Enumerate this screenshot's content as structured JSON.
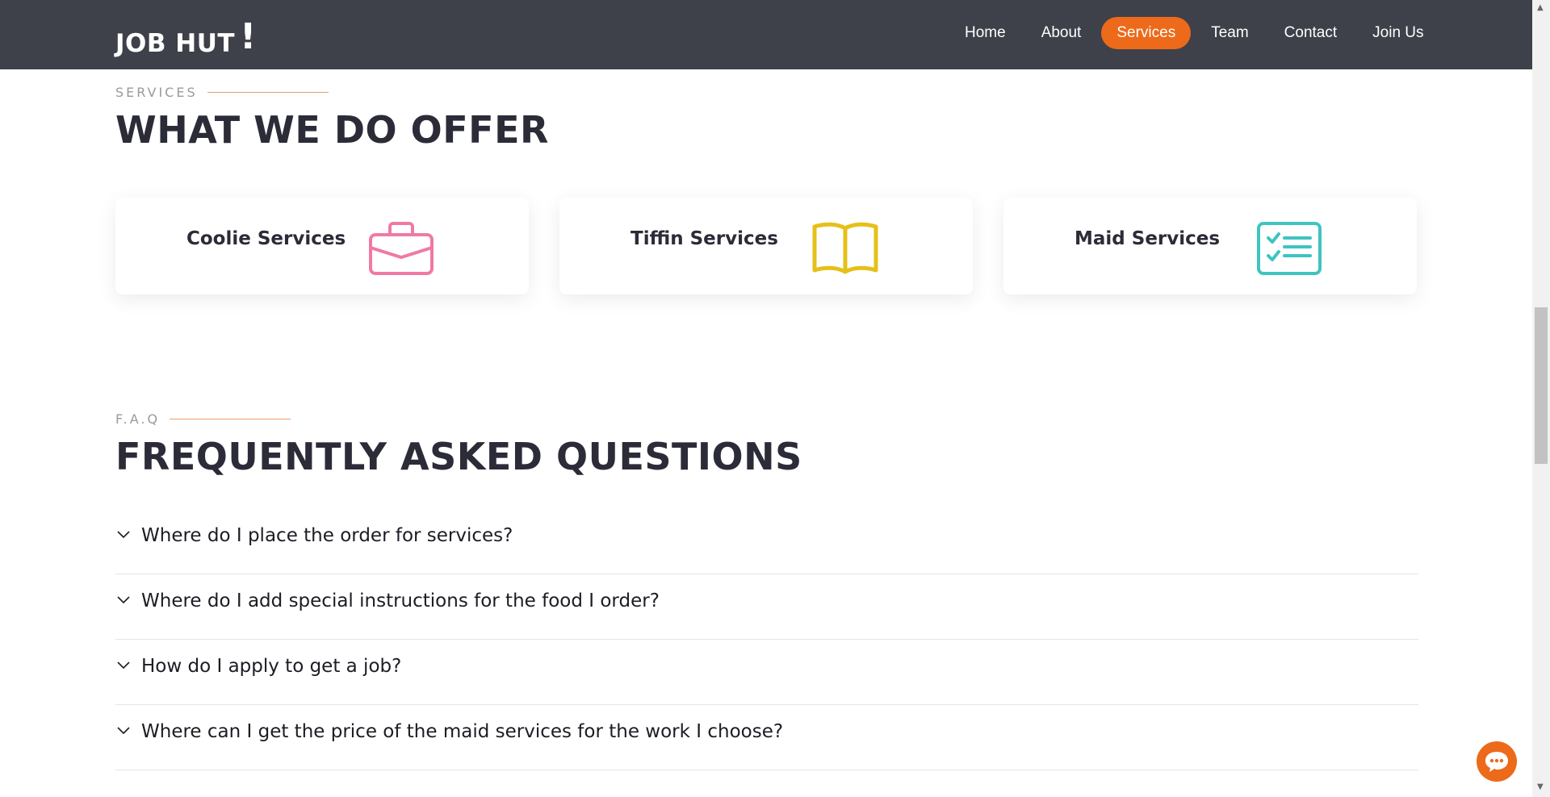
{
  "header": {
    "logo_text": "JOB HUT",
    "logo_mark": "!",
    "nav": [
      {
        "label": "Home",
        "active": false
      },
      {
        "label": "About",
        "active": false
      },
      {
        "label": "Services",
        "active": true
      },
      {
        "label": "Team",
        "active": false
      },
      {
        "label": "Contact",
        "active": false
      },
      {
        "label": "Join Us",
        "active": false
      }
    ]
  },
  "services": {
    "eyebrow": "SERVICES",
    "heading": "WHAT WE DO OFFER",
    "cards": [
      {
        "title": "Coolie Services",
        "icon": "briefcase-icon",
        "color": "#ef7aa5"
      },
      {
        "title": "Tiffin Services",
        "icon": "book-icon",
        "color": "#e6c018"
      },
      {
        "title": "Maid Services",
        "icon": "checklist-icon",
        "color": "#3fc4c0"
      }
    ]
  },
  "faq": {
    "eyebrow": "F.A.Q",
    "heading": "FREQUENTLY ASKED QUESTIONS",
    "items": [
      "Where do I place the order for services?",
      "Where do I add special instructions for the food I order?",
      "How do I apply to get a job?",
      "Where can I get the price of the maid services for the work I choose?"
    ]
  },
  "colors": {
    "header_bg": "#3e4149",
    "accent": "#ec6a1a",
    "heading": "#2b2c38"
  },
  "chat": {
    "icon": "chat-bubble-icon"
  }
}
